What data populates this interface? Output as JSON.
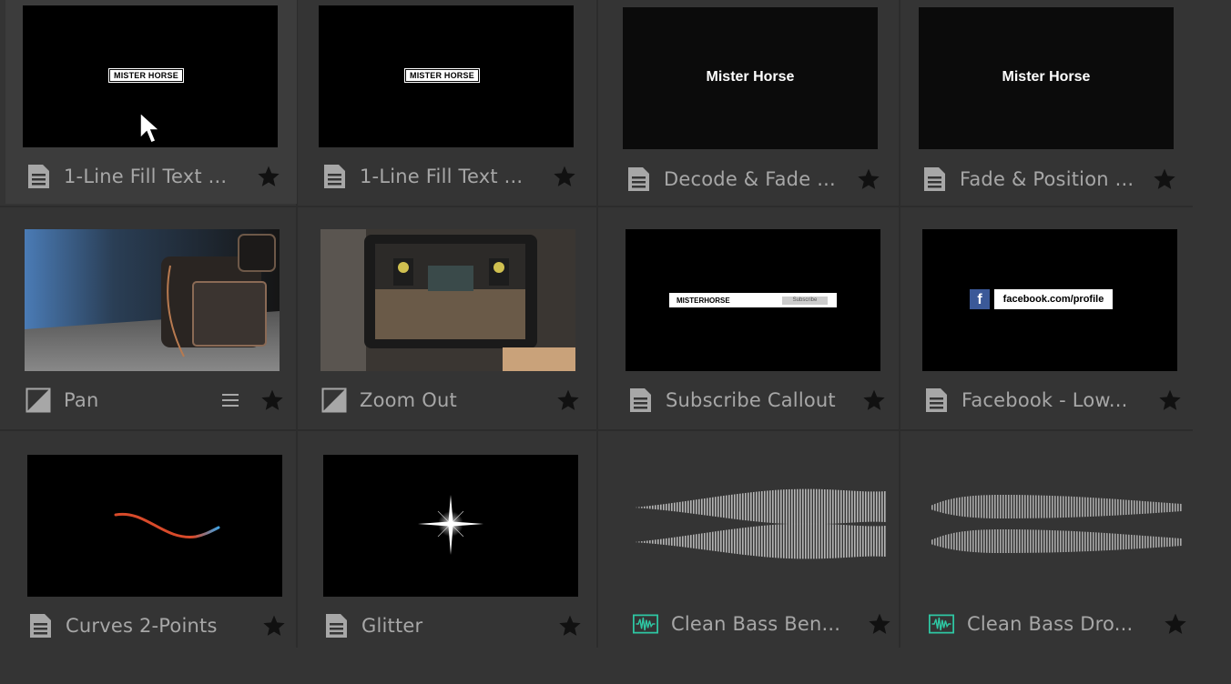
{
  "tiles": [
    {
      "label": "1-Line Fill Text ...",
      "icon": "document-icon",
      "thumb_text": "MISTER HORSE",
      "selected": true
    },
    {
      "label": "1-Line Fill Text ...",
      "icon": "document-icon",
      "thumb_text": "MISTER HORSE"
    },
    {
      "label": "Decode & Fade ...",
      "icon": "document-icon",
      "thumb_text": "Mister Horse"
    },
    {
      "label": "Fade & Position ...",
      "icon": "document-icon",
      "thumb_text": "Mister Horse"
    },
    {
      "label": "Pan",
      "icon": "transition-icon",
      "has_menu": true
    },
    {
      "label": "Zoom Out",
      "icon": "transition-icon"
    },
    {
      "label": "Subscribe Callout",
      "icon": "document-icon",
      "thumb_text": "MISTERHORSE",
      "thumb_text_2": "Subscribe"
    },
    {
      "label": "Facebook - Low...",
      "icon": "document-icon",
      "thumb_text": "facebook.com/profile"
    },
    {
      "label": "Curves 2-Points",
      "icon": "document-icon"
    },
    {
      "label": "Glitter",
      "icon": "document-icon"
    },
    {
      "label": "Clean Bass Ben...",
      "icon": "audio-icon"
    },
    {
      "label": "Clean Bass Dro...",
      "icon": "audio-icon"
    }
  ],
  "colors": {
    "background": "#343434",
    "label": "#a7a7a7",
    "icon": "#a7a7a7",
    "star": "#111111",
    "audio_icon": "#2ec7a3",
    "selected_tile": "#3c3c3c"
  }
}
